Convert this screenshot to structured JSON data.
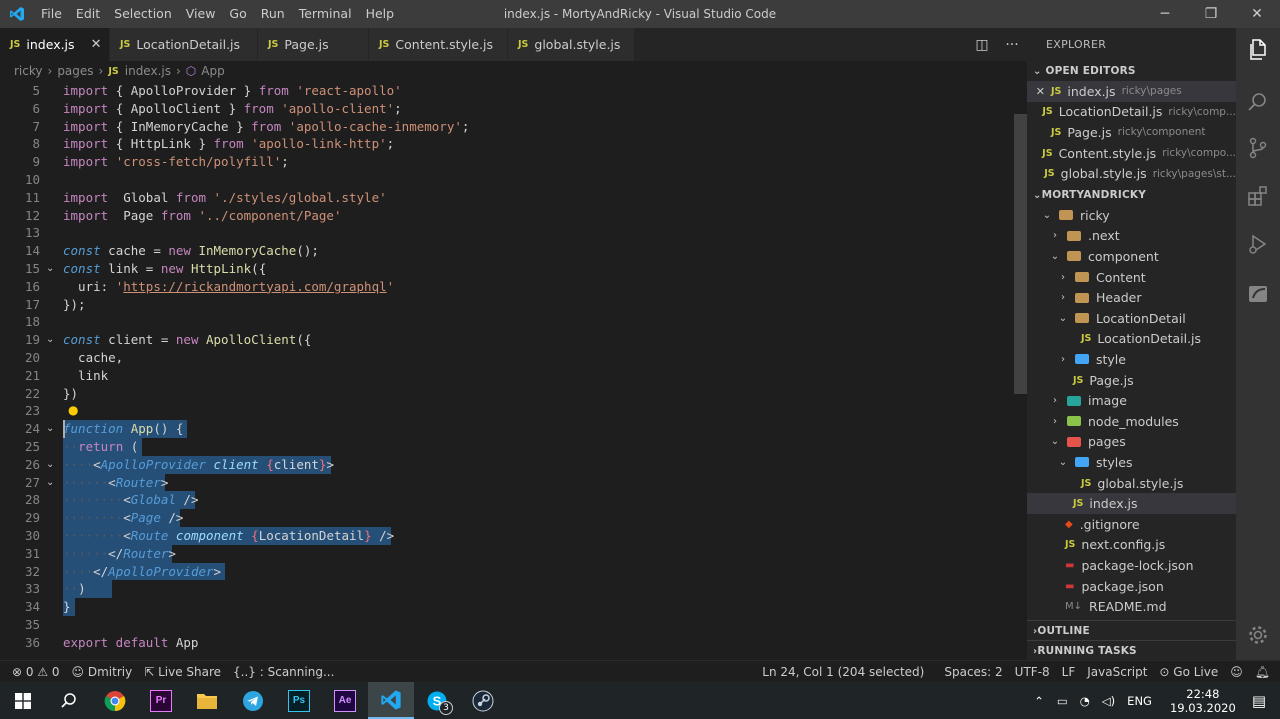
{
  "window": {
    "title": "index.js - MortyAndRicky - Visual Studio Code",
    "menu": [
      "File",
      "Edit",
      "Selection",
      "View",
      "Go",
      "Run",
      "Terminal",
      "Help"
    ],
    "controls": [
      "─",
      "❐",
      "✕"
    ]
  },
  "tabs": [
    {
      "badge": "JS",
      "label": "index.js",
      "active": true
    },
    {
      "badge": "JS",
      "label": "LocationDetail.js"
    },
    {
      "badge": "JS",
      "label": "Page.js"
    },
    {
      "badge": "JS",
      "label": "Content.style.js"
    },
    {
      "badge": "JS",
      "label": "global.style.js"
    }
  ],
  "breadcrumb": {
    "parts": [
      "ricky",
      "pages",
      "index.js",
      "App"
    ],
    "js_badge": "JS"
  },
  "editor": {
    "line_numbers": [
      "5",
      "6",
      "7",
      "8",
      "9",
      "10",
      "11",
      "12",
      "13",
      "14",
      "15",
      "16",
      "17",
      "18",
      "19",
      "20",
      "21",
      "22",
      "23",
      "24",
      "25",
      "26",
      "27",
      "28",
      "29",
      "30",
      "31",
      "32",
      "33",
      "34",
      "35",
      "36"
    ],
    "lines": [
      {
        "t": [
          [
            "kw",
            "import"
          ],
          [
            "",
            "{ ApolloProvider } "
          ],
          [
            "kw",
            "from"
          ],
          [
            "str",
            " 'react-apollo'"
          ]
        ]
      },
      {
        "t": [
          [
            "kw",
            "import"
          ],
          [
            "",
            "{ ApolloClient } "
          ],
          [
            "kw",
            "from"
          ],
          [
            "str",
            " 'apollo-client'"
          ],
          [
            "",
            ";"
          ]
        ]
      },
      {
        "t": [
          [
            "kw",
            "import"
          ],
          [
            "",
            "{ InMemoryCache } "
          ],
          [
            "kw",
            "from"
          ],
          [
            "str",
            " 'apollo-cache-inmemory'"
          ],
          [
            "",
            ";"
          ]
        ]
      },
      {
        "t": [
          [
            "kw",
            "import"
          ],
          [
            "",
            "{ HttpLink } "
          ],
          [
            "kw",
            "from"
          ],
          [
            "str",
            " 'apollo-link-http'"
          ],
          [
            "",
            ";"
          ]
        ]
      },
      {
        "t": [
          [
            "kw",
            "import"
          ],
          [
            "str",
            "'cross-fetch/polyfill'"
          ],
          [
            "",
            ";"
          ]
        ]
      },
      {
        "t": []
      },
      {
        "t": [
          [
            "kw",
            "import"
          ],
          [
            "",
            " Global "
          ],
          [
            "kw",
            "from"
          ],
          [
            "str",
            " './styles/global.style'"
          ]
        ]
      },
      {
        "t": [
          [
            "kw",
            "import"
          ],
          [
            "",
            " Page "
          ],
          [
            "kw",
            "from"
          ],
          [
            "str",
            " '../component/Page'"
          ]
        ]
      },
      {
        "t": []
      },
      {
        "t": [
          [
            "kwb",
            "const"
          ],
          [
            "",
            " cache = "
          ],
          [
            "kw",
            "new"
          ],
          [
            "fn",
            " InMemoryCache"
          ],
          [
            "",
            "();"
          ]
        ]
      },
      {
        "t": [
          [
            "kwb",
            "const"
          ],
          [
            "",
            " link = "
          ],
          [
            "kw",
            "new"
          ],
          [
            "fn",
            " HttpLink"
          ],
          [
            "",
            "({"
          ]
        ]
      },
      {
        "t": [
          [
            "",
            "  uri: "
          ],
          [
            "str",
            "'"
          ],
          [
            "url",
            "https://rickandmortyapi.com/graphql"
          ],
          [
            "str",
            "'"
          ]
        ]
      },
      {
        "t": [
          [
            "",
            "});"
          ]
        ]
      },
      {
        "t": []
      },
      {
        "t": [
          [
            "kwb",
            "const"
          ],
          [
            "",
            " client = "
          ],
          [
            "kw",
            "new"
          ],
          [
            "fn",
            " ApolloClient"
          ],
          [
            "",
            "({"
          ]
        ]
      },
      {
        "t": [
          [
            "",
            "  cache,"
          ]
        ]
      },
      {
        "t": [
          [
            "",
            "  link"
          ]
        ]
      },
      {
        "t": [
          [
            "",
            "})"
          ]
        ]
      },
      {
        "t": []
      },
      {
        "t": [
          [
            "kwb",
            "function"
          ],
          [
            "fn",
            " App"
          ],
          [
            "",
            "() {"
          ]
        ]
      },
      {
        "t": [
          [
            "dim",
            "··"
          ],
          [
            "kw",
            "return"
          ],
          [
            "",
            " ("
          ]
        ]
      },
      {
        "t": [
          [
            "dim",
            "····"
          ],
          [
            "",
            "<"
          ],
          [
            "tag",
            "ApolloProvider"
          ],
          [
            "attr",
            " client"
          ],
          [
            "",
            ""
          ],
          [
            "pink",
            " {"
          ],
          [
            "",
            "client"
          ],
          [
            "pink",
            "}"
          ],
          [
            "",
            ">"
          ]
        ]
      },
      {
        "t": [
          [
            "dim",
            "······"
          ],
          [
            "",
            "<"
          ],
          [
            "tag",
            "Router"
          ],
          [
            "",
            ">"
          ]
        ]
      },
      {
        "t": [
          [
            "dim",
            "········"
          ],
          [
            "",
            "<"
          ],
          [
            "tag",
            "Global"
          ],
          [
            "",
            " />"
          ]
        ]
      },
      {
        "t": [
          [
            "dim",
            "········"
          ],
          [
            "",
            "<"
          ],
          [
            "tag",
            "Page"
          ],
          [
            "",
            " />"
          ]
        ]
      },
      {
        "t": [
          [
            "dim",
            "········"
          ],
          [
            "",
            "<"
          ],
          [
            "tag",
            "Route"
          ],
          [
            "attr",
            " component"
          ],
          [
            "pink",
            " {"
          ],
          [
            "",
            "LocationDetail"
          ],
          [
            "pink",
            "}"
          ],
          [
            "",
            " />"
          ]
        ]
      },
      {
        "t": [
          [
            "dim",
            "······"
          ],
          [
            "",
            "</"
          ],
          [
            "tag",
            "Router"
          ],
          [
            "",
            ">"
          ]
        ]
      },
      {
        "t": [
          [
            "dim",
            "····"
          ],
          [
            "",
            "</"
          ],
          [
            "tag",
            "ApolloProvider"
          ],
          [
            "",
            ">"
          ]
        ]
      },
      {
        "t": [
          [
            "dim",
            "··"
          ],
          [
            "",
            ")"
          ]
        ]
      },
      {
        "t": [
          [
            "",
            "}"
          ]
        ]
      },
      {
        "t": []
      },
      {
        "t": [
          [
            "kw",
            "export default"
          ],
          [
            "",
            " App"
          ]
        ]
      }
    ]
  },
  "explorer": {
    "title": "EXPLORER",
    "open_editors_label": "OPEN EDITORS",
    "open_editors": [
      {
        "name": "index.js",
        "path": "ricky\\pages",
        "close": "✕",
        "selected": true
      },
      {
        "name": "LocationDetail.js",
        "path": "ricky\\comp..."
      },
      {
        "name": "Page.js",
        "path": "ricky\\component"
      },
      {
        "name": "Content.style.js",
        "path": "ricky\\compo..."
      },
      {
        "name": "global.style.js",
        "path": "ricky\\pages\\st..."
      }
    ],
    "project_label": "MORTYANDRICKY",
    "tree": [
      {
        "name": "ricky",
        "depth": 1,
        "chev": "⌄",
        "kind": "folder-open"
      },
      {
        "name": ".next",
        "depth": 2,
        "chev": "›",
        "kind": "folder"
      },
      {
        "name": "component",
        "depth": 2,
        "chev": "⌄",
        "kind": "folder-open"
      },
      {
        "name": "Content",
        "depth": 3,
        "chev": "›",
        "kind": "folder"
      },
      {
        "name": "Header",
        "depth": 3,
        "chev": "›",
        "kind": "folder"
      },
      {
        "name": "LocationDetail",
        "depth": 3,
        "chev": "⌄",
        "kind": "folder-open"
      },
      {
        "name": "LocationDetail.js",
        "depth": 4,
        "chev": "",
        "kind": "js"
      },
      {
        "name": "style",
        "depth": 3,
        "chev": "›",
        "kind": "folder-blue"
      },
      {
        "name": "Page.js",
        "depth": 3,
        "chev": "",
        "kind": "js"
      },
      {
        "name": "image",
        "depth": 2,
        "chev": "›",
        "kind": "folder-teal"
      },
      {
        "name": "node_modules",
        "depth": 2,
        "chev": "›",
        "kind": "folder-green"
      },
      {
        "name": "pages",
        "depth": 2,
        "chev": "⌄",
        "kind": "folder-red"
      },
      {
        "name": "styles",
        "depth": 3,
        "chev": "⌄",
        "kind": "folder-blue"
      },
      {
        "name": "global.style.js",
        "depth": 4,
        "chev": "",
        "kind": "js"
      },
      {
        "name": "index.js",
        "depth": 3,
        "chev": "",
        "kind": "js",
        "selected": true
      },
      {
        "name": ".gitignore",
        "depth": 2,
        "chev": "",
        "kind": "git"
      },
      {
        "name": "next.config.js",
        "depth": 2,
        "chev": "",
        "kind": "js"
      },
      {
        "name": "package-lock.json",
        "depth": 2,
        "chev": "",
        "kind": "npm"
      },
      {
        "name": "package.json",
        "depth": 2,
        "chev": "",
        "kind": "npm"
      },
      {
        "name": "README.md",
        "depth": 2,
        "chev": "",
        "kind": "md"
      }
    ],
    "outline_label": "OUTLINE",
    "running_tasks_label": "RUNNING TASKS",
    "js_badge": "JS"
  },
  "statusbar": {
    "errors": "⊗ 0 ⚠ 0",
    "user": "Dmitriy",
    "live_share": "Live Share",
    "scanning": "{..} : Scanning...",
    "position": "Ln 24, Col 1 (204 selected)",
    "spaces": "Spaces: 2",
    "encoding": "UTF-8",
    "eol": "LF",
    "language": "JavaScript",
    "go_live": "Go Live"
  },
  "taskbar": {
    "lang": "ENG",
    "time": "22:48",
    "date": "19.03.2020",
    "skype_badge": "3"
  },
  "colors": {
    "accent": "#007acc",
    "selection": "#264f78",
    "js_icon": "#cbcb41"
  }
}
